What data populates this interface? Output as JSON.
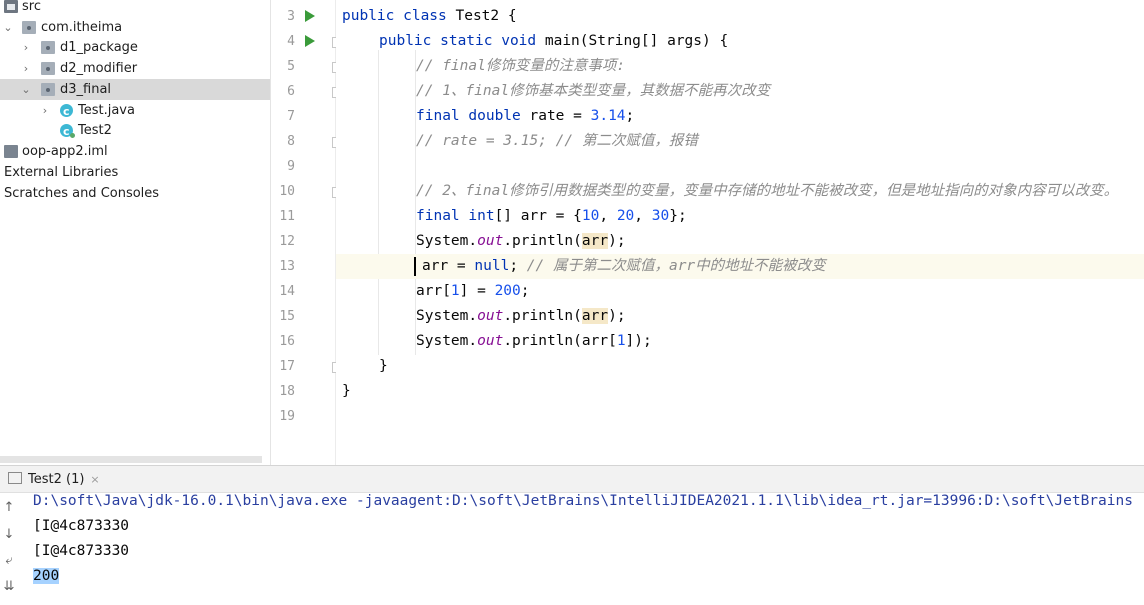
{
  "project_tree": {
    "items": [
      {
        "label": "src",
        "icon": "folder-icon",
        "expanded": true
      },
      {
        "label": "com.itheima",
        "icon": "package-icon",
        "expanded": true
      },
      {
        "label": "d1_package",
        "icon": "package-icon",
        "expanded": false
      },
      {
        "label": "d2_modifier",
        "icon": "package-icon",
        "expanded": false
      },
      {
        "label": "d3_final",
        "icon": "package-icon",
        "expanded": true,
        "selected": true
      },
      {
        "label": "Test.java",
        "icon": "java-file-icon",
        "expanded": false
      },
      {
        "label": "Test2",
        "icon": "java-class-icon"
      },
      {
        "label": "oop-app2.iml",
        "icon": "iml-file-icon"
      },
      {
        "label": "External Libraries",
        "icon": "library-icon"
      },
      {
        "label": "Scratches and Consoles",
        "icon": "scratch-icon"
      }
    ]
  },
  "editor": {
    "line_numbers": [
      "3",
      "4",
      "5",
      "6",
      "7",
      "8",
      "9",
      "10",
      "11",
      "12",
      "13",
      "14",
      "15",
      "16",
      "17",
      "18",
      "19"
    ],
    "current_line": "13",
    "lines": {
      "l3": {
        "kw": "public class",
        "rest": " Test2 {"
      },
      "l4": {
        "kw1": "public static void",
        "name": " main(String[] args) {"
      },
      "l5": {
        "comment": "// final修饰变量的注意事项:"
      },
      "l6": {
        "comment": "// 1、final修饰基本类型变量，其数据不能再次改变"
      },
      "l7": {
        "kw": "final double",
        "mid": " rate = ",
        "num": "3.14",
        "end": ";"
      },
      "l8": {
        "comment": "// rate = 3.15; // 第二次赋值，报错"
      },
      "l10": {
        "comment": "// 2、final修饰引用数据类型的变量，变量中存储的地址不能被改变，但是地址指向的对象内容可以改变。"
      },
      "l11": {
        "kw": "final int",
        "mid": "[] arr = {",
        "n1": "10",
        "c1": ", ",
        "n2": "20",
        "c2": ", ",
        "n3": "30",
        "end": "};"
      },
      "l12": {
        "pre": "System.",
        "static": "out",
        "mid": ".println(",
        "var": "arr",
        "end": ");"
      },
      "l13": {
        "pre": "arr = ",
        "kw": "null",
        "mid": "; ",
        "comment": "// 属于第二次赋值，arr中的地址不能被改变"
      },
      "l14": {
        "pre": "arr[",
        "num": "1",
        "mid": "] = ",
        "num2": "200",
        "end": ";"
      },
      "l15": {
        "pre": "System.",
        "static": "out",
        "mid": ".println(",
        "var": "arr",
        "end": ");"
      },
      "l16": {
        "pre": "System.",
        "static": "out",
        "mid": ".println(arr[",
        "num": "1",
        "end": "]);"
      },
      "l17": {
        "text": "}"
      },
      "l18": {
        "text": "}"
      }
    }
  },
  "run_panel": {
    "tab_label": "Test2 (1)",
    "close_label": "×",
    "output": [
      "D:\\soft\\Java\\jdk-16.0.1\\bin\\java.exe -javaagent:D:\\soft\\JetBrains\\IntelliJIDEA2021.1.1\\lib\\idea_rt.jar=13996:D:\\soft\\JetBrains",
      "[I@4c873330",
      "[I@4c873330",
      "200"
    ]
  },
  "colors": {
    "keyword": "#0033b3",
    "number": "#1750eb",
    "comment": "#8c8c8c",
    "static_field": "#871094",
    "run_icon": "#3a9b3a",
    "selection": "#a6d2ff"
  }
}
